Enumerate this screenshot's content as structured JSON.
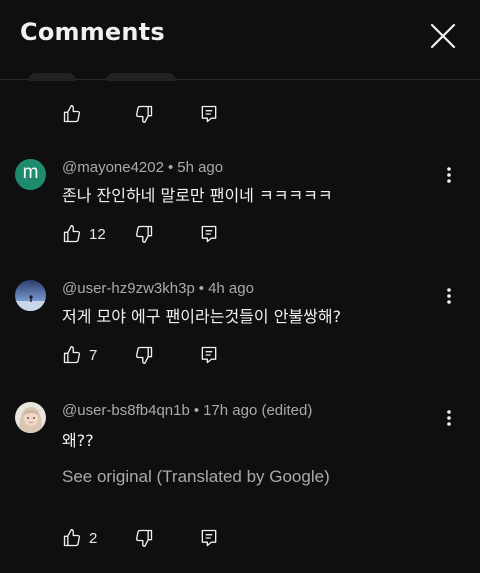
{
  "header": {
    "title": "Comments"
  },
  "comments": [
    {
      "author": "@mayone4202",
      "time": "5h ago",
      "text": "존나 잔인하네 말로만 팬이네 ㅋㅋㅋㅋㅋ",
      "likes": "12",
      "avatar_letter": "m",
      "avatar_color": "#1e8a6e"
    },
    {
      "author": "@user-hz9zw3kh3p",
      "time": "4h ago",
      "text": "저게 모야 에구 팬이라는것들이 안불쌍해?",
      "likes": "7"
    },
    {
      "author": "@user-bs8fb4qn1b",
      "time": "17h ago (edited)",
      "text": "왜??",
      "translate_link": "See original (Translated by Google)",
      "likes": "2"
    }
  ],
  "colors": {
    "background": "#0f0f0f",
    "text_primary": "#f1f1f1",
    "text_secondary": "#aaaaaa"
  }
}
